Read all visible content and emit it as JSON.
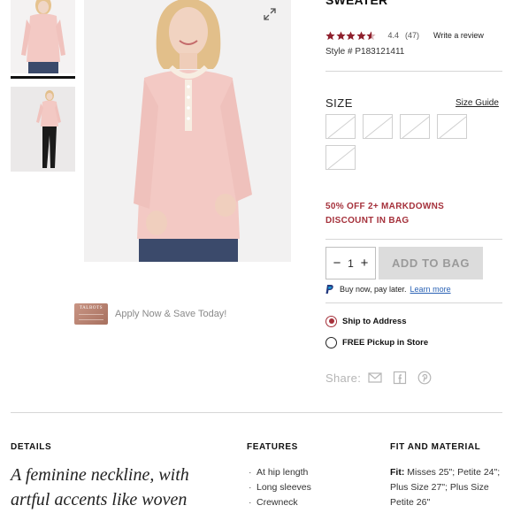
{
  "product": {
    "title_line": "SWEATER",
    "rating_value": "4.4",
    "review_count": "(47)",
    "write_review": "Write a review",
    "style_number": "Style # P183121411"
  },
  "promo_card": {
    "brand": "TALBOTS",
    "text": "Apply Now & Save Today!"
  },
  "size": {
    "label": "SIZE",
    "guide": "Size Guide"
  },
  "promo": {
    "line1": "50% OFF 2+ MARKDOWNS",
    "line2": "DISCOUNT IN BAG"
  },
  "cart": {
    "quantity": "1",
    "add_label": "ADD TO BAG"
  },
  "paypal": {
    "text": "Buy now, pay later.",
    "link": "Learn more"
  },
  "delivery": {
    "ship": "Ship to Address",
    "pickup": "FREE Pickup in Store"
  },
  "share": {
    "label": "Share:"
  },
  "details": {
    "heading": "DETAILS",
    "text": "A feminine neckline, with artful accents like woven"
  },
  "features": {
    "heading": "FEATURES",
    "items": [
      "At hip length",
      "Long sleeves",
      "Crewneck"
    ]
  },
  "fit": {
    "heading": "FIT AND MATERIAL",
    "label": "Fit:",
    "text": "Misses 25\"; Petite 24\"; Plus Size 27\"; Plus Size Petite 26\""
  },
  "colors": {
    "accent": "#a5313b",
    "star": "#8e1f2c",
    "link": "#2a62b5",
    "sweater": "#f3c9c4",
    "jeans": "#3b4a6b"
  }
}
